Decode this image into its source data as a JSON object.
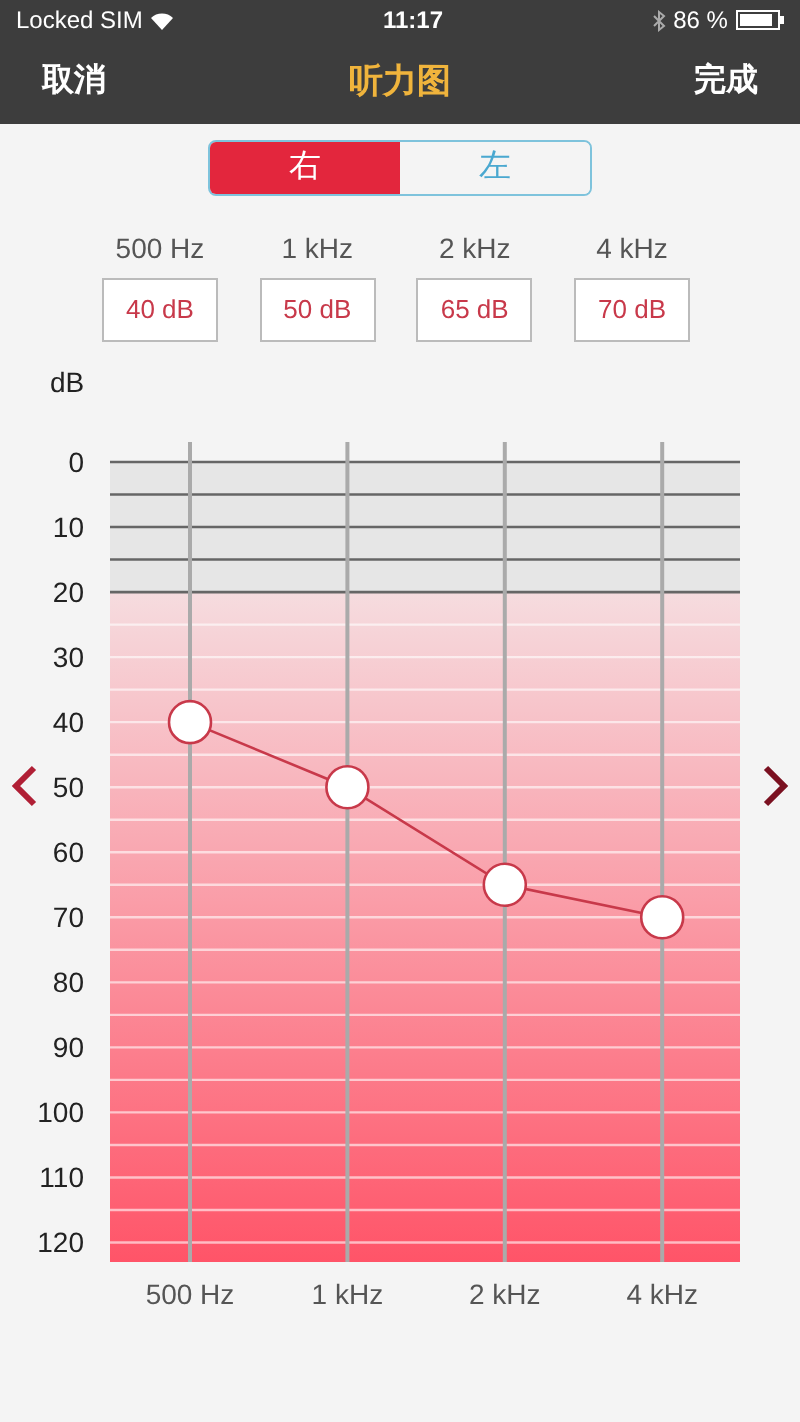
{
  "status_bar": {
    "carrier": "Locked SIM",
    "time": "11:17",
    "battery": "86 %"
  },
  "nav": {
    "left": "取消",
    "title": "听力图",
    "right": "完成"
  },
  "tabs": [
    {
      "label": "右",
      "selected": true
    },
    {
      "label": "左",
      "selected": false
    }
  ],
  "thresholds": [
    {
      "frequency": "500 Hz",
      "value": "40 dB"
    },
    {
      "frequency": "1 kHz",
      "value": "50 dB"
    },
    {
      "frequency": "2 kHz",
      "value": "65 dB"
    },
    {
      "frequency": "4 kHz",
      "value": "70 dB"
    }
  ],
  "chart_data": {
    "type": "line",
    "ylabel": "dB",
    "categories": [
      "500 Hz",
      "1 kHz",
      "2 kHz",
      "4 kHz"
    ],
    "series": [
      {
        "color": "#c8394a",
        "marker": "o",
        "values": [
          40,
          50,
          65,
          70
        ]
      }
    ],
    "ylim": [
      123,
      0
    ],
    "grid": true,
    "bands": [
      {
        "axis": "y",
        "from": 0,
        "to": 20,
        "color": "#e6e6e6"
      },
      {
        "axis": "y",
        "from": 20,
        "to": 123,
        "color": "#ff5468"
      }
    ],
    "yticks": [
      0,
      10,
      20,
      30,
      40,
      50,
      60,
      70,
      80,
      90,
      100,
      110,
      120
    ]
  }
}
